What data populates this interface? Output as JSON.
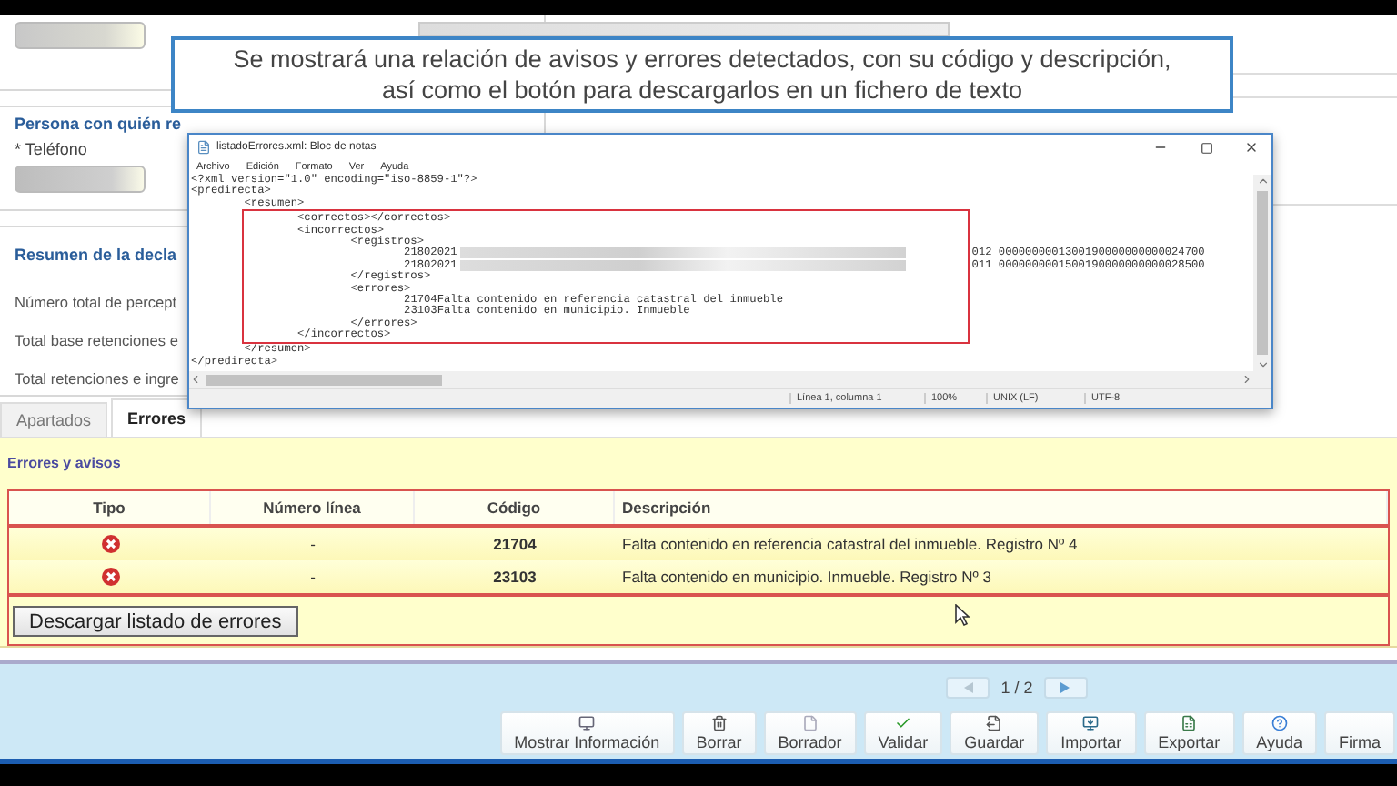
{
  "caption": {
    "lines": [
      "Se mostrará una relación de avisos y errores detectados, con su código y descripción,",
      "así como el botón para descargarlos en un fichero de texto"
    ]
  },
  "form": {
    "sections": [
      {
        "kind": "contact",
        "title": "Persona con quién re",
        "label": "Teléfono",
        "required_mark": "*"
      },
      {
        "kind": "summary",
        "title": "Resumen de la decla",
        "rows": [
          "Número total de percept",
          "Total base retenciones e",
          "Total retenciones e ingre"
        ]
      }
    ]
  },
  "notepad": {
    "title": "listadoErrores.xml: Bloc de notas",
    "menu": [
      "Archivo",
      "Edición",
      "Formato",
      "Ver",
      "Ayuda"
    ],
    "lines": [
      {
        "kind": "text",
        "text": "<?xml version=\"1.0\" encoding=\"iso-8859-1\"?>"
      },
      {
        "kind": "text",
        "text": "<predirecta>"
      },
      {
        "kind": "text",
        "text": "\t<resumen>"
      },
      {
        "kind": "text",
        "text": "\t\t<correctos></correctos>"
      },
      {
        "kind": "text",
        "text": "\t\t<incorrectos>"
      },
      {
        "kind": "text",
        "text": "\t\t\t<registros>"
      },
      {
        "kind": "record",
        "start": "\t\t\t\t21802021",
        "end": "012 0000000001300190000000000024700"
      },
      {
        "kind": "record",
        "start": "\t\t\t\t21802021",
        "end": "011 0000000001500190000000000028500"
      },
      {
        "kind": "text",
        "text": "\t\t\t</registros>"
      },
      {
        "kind": "text",
        "text": "\t\t\t<errores>"
      },
      {
        "kind": "text",
        "text": "\t\t\t\t21704Falta contenido en referencia catastral del inmueble"
      },
      {
        "kind": "text",
        "text": "\t\t\t\t23103Falta contenido en municipio. Inmueble"
      },
      {
        "kind": "text",
        "text": "\t\t\t</errores>"
      },
      {
        "kind": "text",
        "text": "\t\t</incorrectos>"
      },
      {
        "kind": "text",
        "text": "\t</resumen>"
      },
      {
        "kind": "text",
        "text": "</predirecta>"
      }
    ],
    "status": [
      "Línea 1, columna 1",
      "100%",
      "UNIX (LF)",
      "UTF-8"
    ]
  },
  "tabs": [
    {
      "label": "Apartados",
      "selected": false
    },
    {
      "label": "Errores",
      "selected": true
    }
  ],
  "errors_panel": {
    "title": "Errores y avisos",
    "columns": [
      "Tipo",
      "Número línea",
      "Código",
      "Descripción"
    ],
    "rows": [
      {
        "kind": "error",
        "line": "-",
        "code": "21704",
        "description": "Falta contenido en referencia catastral del inmueble. Registro Nº 4"
      },
      {
        "kind": "error",
        "line": "-",
        "code": "23103",
        "description": "Falta contenido en municipio. Inmueble. Registro Nº 3"
      }
    ],
    "download_button": "Descargar listado de errores"
  },
  "pager": {
    "page": "1 / 2",
    "prev_disabled": true,
    "next_disabled": false
  },
  "toolbar": [
    "Mostrar Información",
    "Borrar",
    "Borrador",
    "Validar",
    "Guardar",
    "Importar",
    "Exportar",
    "Ayuda",
    "Firma"
  ]
}
